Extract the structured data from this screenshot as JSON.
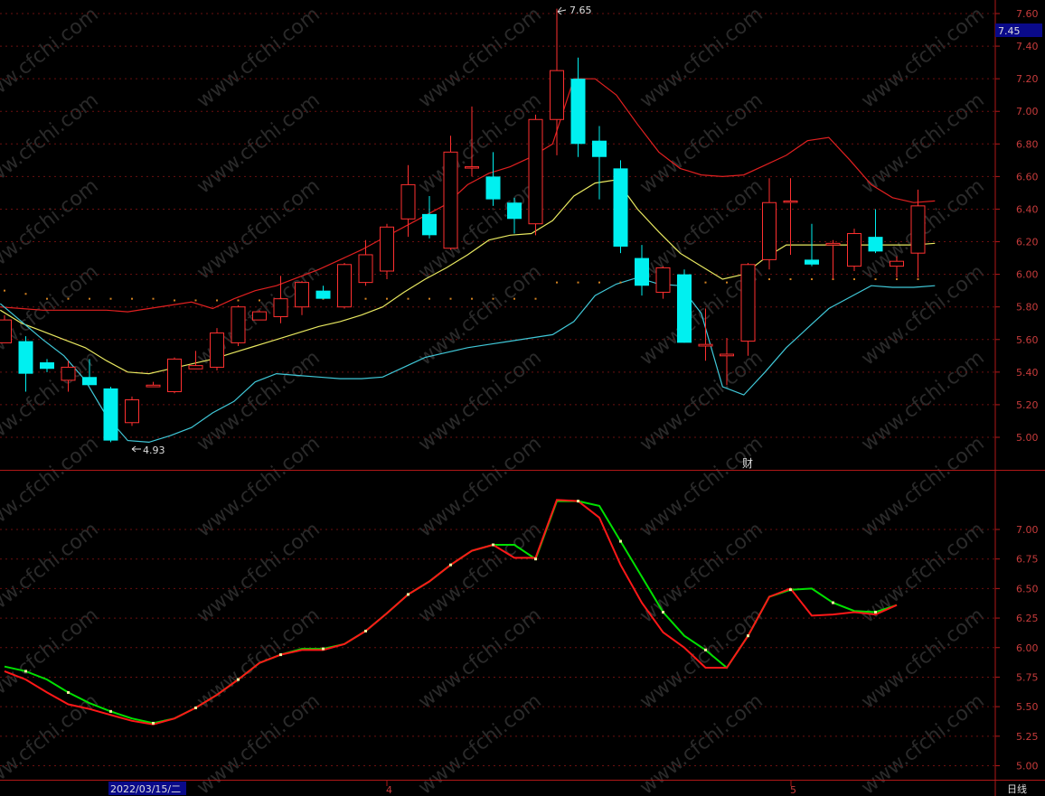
{
  "chart_data": [
    {
      "type": "candlestick",
      "ylim": [
        4.8,
        7.65
      ],
      "yticks": [
        "7.60",
        "7.40",
        "7.20",
        "7.00",
        "6.80",
        "6.60",
        "6.40",
        "6.20",
        "6.00",
        "5.80",
        "5.60",
        "5.40",
        "5.20",
        "5.00"
      ],
      "current_price": "7.45",
      "high_label": "7.65",
      "low_label": "4.93",
      "event_label": "财",
      "candles": [
        {
          "o": 5.58,
          "h": 5.75,
          "l": 5.58,
          "c": 5.72
        },
        {
          "o": 5.59,
          "h": 5.62,
          "l": 5.28,
          "c": 5.39
        },
        {
          "o": 5.46,
          "h": 5.48,
          "l": 5.4,
          "c": 5.42
        },
        {
          "o": 5.35,
          "h": 5.47,
          "l": 5.28,
          "c": 5.43
        },
        {
          "o": 5.37,
          "h": 5.48,
          "l": 5.32,
          "c": 5.32
        },
        {
          "o": 5.3,
          "h": 5.31,
          "l": 4.97,
          "c": 4.98
        },
        {
          "o": 5.09,
          "h": 5.25,
          "l": 5.07,
          "c": 5.23
        },
        {
          "o": 5.31,
          "h": 5.34,
          "l": 5.31,
          "c": 5.32
        },
        {
          "o": 5.28,
          "h": 5.49,
          "l": 5.27,
          "c": 5.48
        },
        {
          "o": 5.42,
          "h": 5.53,
          "l": 5.42,
          "c": 5.44
        },
        {
          "o": 5.43,
          "h": 5.67,
          "l": 5.41,
          "c": 5.64
        },
        {
          "o": 5.58,
          "h": 5.81,
          "l": 5.56,
          "c": 5.8
        },
        {
          "o": 5.72,
          "h": 5.78,
          "l": 5.72,
          "c": 5.77
        },
        {
          "o": 5.74,
          "h": 5.99,
          "l": 5.7,
          "c": 5.85
        },
        {
          "o": 5.8,
          "h": 5.96,
          "l": 5.75,
          "c": 5.95
        },
        {
          "o": 5.9,
          "h": 5.93,
          "l": 5.85,
          "c": 5.85
        },
        {
          "o": 5.8,
          "h": 6.07,
          "l": 5.79,
          "c": 6.06
        },
        {
          "o": 5.95,
          "h": 6.21,
          "l": 5.93,
          "c": 6.12
        },
        {
          "o": 6.02,
          "h": 6.31,
          "l": 5.97,
          "c": 6.29
        },
        {
          "o": 6.34,
          "h": 6.67,
          "l": 6.23,
          "c": 6.55
        },
        {
          "o": 6.37,
          "h": 6.48,
          "l": 6.22,
          "c": 6.24
        },
        {
          "o": 6.16,
          "h": 6.85,
          "l": 6.15,
          "c": 6.75
        },
        {
          "o": 6.66,
          "h": 7.03,
          "l": 6.6,
          "c": 6.66
        },
        {
          "o": 6.6,
          "h": 6.75,
          "l": 6.42,
          "c": 6.46
        },
        {
          "o": 6.44,
          "h": 6.47,
          "l": 6.25,
          "c": 6.34
        },
        {
          "o": 6.31,
          "h": 6.98,
          "l": 6.24,
          "c": 6.95
        },
        {
          "o": 6.95,
          "h": 7.63,
          "l": 6.73,
          "c": 7.25
        },
        {
          "o": 7.2,
          "h": 7.33,
          "l": 6.72,
          "c": 6.8
        },
        {
          "o": 6.82,
          "h": 6.91,
          "l": 6.46,
          "c": 6.72
        },
        {
          "o": 6.65,
          "h": 6.7,
          "l": 6.13,
          "c": 6.17
        },
        {
          "o": 6.1,
          "h": 6.18,
          "l": 5.87,
          "c": 5.93
        },
        {
          "o": 5.89,
          "h": 6.05,
          "l": 5.85,
          "c": 6.04
        },
        {
          "o": 6.0,
          "h": 6.03,
          "l": 5.58,
          "c": 5.58
        },
        {
          "o": 5.56,
          "h": 5.79,
          "l": 5.47,
          "c": 5.57
        },
        {
          "o": 5.5,
          "h": 5.61,
          "l": 5.32,
          "c": 5.51
        },
        {
          "o": 5.59,
          "h": 6.07,
          "l": 5.5,
          "c": 6.06
        },
        {
          "o": 6.09,
          "h": 6.59,
          "l": 6.03,
          "c": 6.44
        },
        {
          "o": 6.45,
          "h": 6.59,
          "l": 6.12,
          "c": 6.45
        },
        {
          "o": 6.09,
          "h": 6.31,
          "l": 6.05,
          "c": 6.06
        },
        {
          "o": 6.18,
          "h": 6.21,
          "l": 5.97,
          "c": 6.19
        },
        {
          "o": 6.05,
          "h": 6.28,
          "l": 6.02,
          "c": 6.25
        },
        {
          "o": 6.23,
          "h": 6.4,
          "l": 6.13,
          "c": 6.14
        },
        {
          "o": 6.05,
          "h": 6.11,
          "l": 5.98,
          "c": 6.08
        },
        {
          "o": 6.13,
          "h": 6.52,
          "l": 5.98,
          "c": 6.42
        }
      ],
      "boll_upper": [
        5.8,
        5.79,
        5.78,
        5.78,
        5.78,
        5.78,
        5.77,
        5.79,
        5.81,
        5.83,
        5.79,
        5.85,
        5.9,
        5.93,
        5.98,
        6.03,
        6.09,
        6.15,
        6.22,
        6.29,
        6.36,
        6.43,
        6.55,
        6.62,
        6.66,
        6.72,
        6.8,
        7.2,
        7.2,
        7.1,
        6.92,
        6.75,
        6.65,
        6.61,
        6.6,
        6.61,
        6.67,
        6.73,
        6.82,
        6.84,
        6.7,
        6.55,
        6.47,
        6.44,
        6.45
      ],
      "boll_mid": [
        5.78,
        5.7,
        5.65,
        5.6,
        5.55,
        5.47,
        5.4,
        5.39,
        5.42,
        5.45,
        5.48,
        5.52,
        5.56,
        5.6,
        5.64,
        5.68,
        5.71,
        5.75,
        5.8,
        5.89,
        5.97,
        6.04,
        6.12,
        6.21,
        6.24,
        6.25,
        6.33,
        6.48,
        6.56,
        6.58,
        6.4,
        6.26,
        6.13,
        6.05,
        5.97,
        6.0,
        6.1,
        6.18,
        6.18,
        6.18,
        6.18,
        6.18,
        6.18,
        6.18,
        6.19
      ],
      "boll_lower": [
        5.82,
        5.71,
        5.6,
        5.5,
        5.35,
        5.13,
        4.98,
        4.97,
        5.01,
        5.06,
        5.15,
        5.22,
        5.34,
        5.39,
        5.38,
        5.37,
        5.36,
        5.36,
        5.37,
        5.43,
        5.49,
        5.52,
        5.55,
        5.57,
        5.59,
        5.61,
        5.63,
        5.71,
        5.87,
        5.94,
        5.98,
        5.94,
        5.93,
        5.76,
        5.31,
        5.26,
        5.4,
        5.55,
        5.67,
        5.79,
        5.86,
        5.93,
        5.92,
        5.92,
        5.93
      ],
      "sar": [
        5.9,
        5.88,
        5.85,
        5.85,
        5.85,
        5.85,
        5.85,
        5.85,
        5.84,
        5.84,
        5.84,
        5.84,
        5.84,
        5.85,
        5.85,
        5.85,
        5.85,
        5.85,
        5.85,
        5.85,
        5.85,
        5.85,
        5.85,
        5.85,
        5.85,
        5.85,
        5.95,
        5.95,
        5.95,
        5.95,
        5.95,
        5.95,
        5.95,
        5.95,
        5.95,
        5.95,
        5.97,
        5.97,
        5.97,
        5.97,
        5.97,
        5.97,
        5.97,
        5.97
      ]
    },
    {
      "type": "line",
      "ylim": [
        4.95,
        7.35
      ],
      "yticks": [
        "7.00",
        "6.75",
        "6.50",
        "6.25",
        "6.00",
        "5.75",
        "5.50",
        "5.25",
        "5.00"
      ],
      "series": [
        {
          "color": "#00e000",
          "values": [
            5.84,
            5.8,
            5.73,
            5.62,
            5.53,
            5.46,
            5.4,
            5.36,
            5.4,
            5.49,
            5.6,
            5.73,
            5.87,
            5.94,
            5.99,
            5.99,
            6.03,
            6.14,
            6.29,
            6.45,
            6.56,
            6.7,
            6.82,
            6.87,
            6.87,
            6.75,
            7.24,
            7.24,
            7.2,
            6.9,
            6.6,
            6.3,
            6.1,
            5.98,
            5.83,
            6.1,
            6.43,
            6.49,
            6.5,
            6.38,
            6.31,
            6.3,
            6.36
          ]
        },
        {
          "color": "#ff1818",
          "values": [
            5.8,
            5.73,
            5.62,
            5.52,
            5.48,
            5.43,
            5.38,
            5.35,
            5.4,
            5.49,
            5.6,
            5.73,
            5.87,
            5.94,
            5.98,
            5.98,
            6.03,
            6.14,
            6.29,
            6.45,
            6.56,
            6.7,
            6.82,
            6.87,
            6.76,
            6.76,
            7.25,
            7.24,
            7.1,
            6.7,
            6.38,
            6.13,
            6.0,
            5.83,
            5.83,
            6.1,
            6.43,
            6.5,
            6.27,
            6.28,
            6.3,
            6.28,
            6.36
          ]
        }
      ]
    }
  ],
  "date_label": "2022/03/15/二",
  "month_labels": [
    "4",
    "5"
  ],
  "period_label": "日线",
  "watermark": "www.cfchi.com"
}
